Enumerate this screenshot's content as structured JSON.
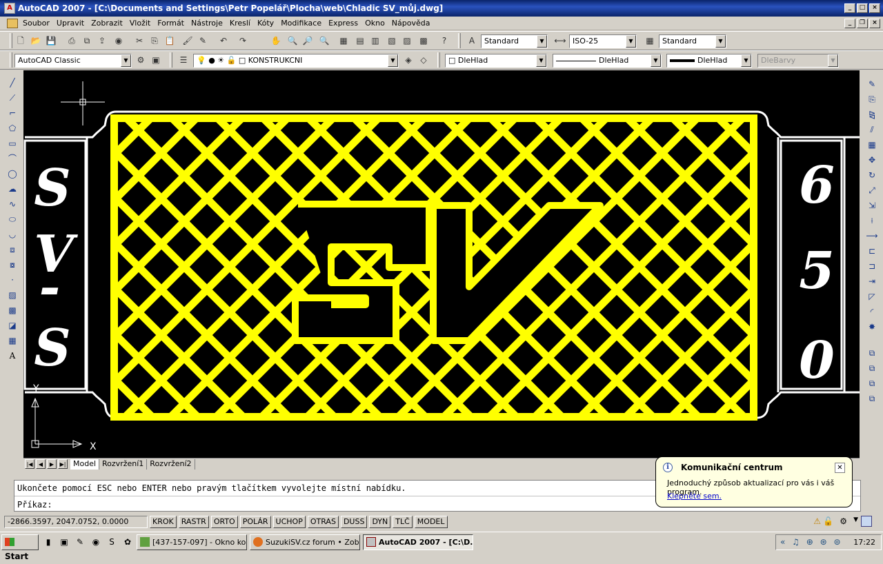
{
  "window": {
    "title": "AutoCAD 2007 - [C:\\Documents and Settings\\Petr Popelář\\Plocha\\web\\Chladic SV_můj.dwg]"
  },
  "menu": [
    "Soubor",
    "Upravit",
    "Zobrazit",
    "Vložit",
    "Formát",
    "Nástroje",
    "Kreslí",
    "Kóty",
    "Modifikace",
    "Express",
    "Okno",
    "Nápověda"
  ],
  "toolbar1": {
    "text_style": "Standard",
    "dim_style": "ISO-25",
    "table_style": "Standard"
  },
  "toolbar2": {
    "workspace": "AutoCAD Classic",
    "layer": "KONSTRUKCNI",
    "color": "DleHlad",
    "linetype": "DleHlad",
    "lineweight": "DleHlad",
    "plotstyle": "DleBarvy"
  },
  "drawing": {
    "left_letters": [
      "S",
      "V",
      "-",
      "S"
    ],
    "right_letters": [
      "6",
      "5",
      "0"
    ],
    "center_logo": "SV",
    "ucs_x": "X",
    "ucs_y": "Y",
    "colors": {
      "background": "#000000",
      "grille": "#ffff00",
      "outline": "#ffffff"
    }
  },
  "layout_tabs": [
    "Model",
    "Rozvržení1",
    "Rozvržení2"
  ],
  "command": {
    "history": "Ukončete pomocí ESC nebo ENTER nebo pravým tlačítkem vyvolejte místní nabídku.",
    "prompt": "Příkaz:"
  },
  "status": {
    "coordinates": "-2866.3597, 2047.0752, 0.0000",
    "toggles": [
      "KROK",
      "RASTR",
      "ORTO",
      "POLÁR",
      "UCHOP",
      "OTRAS",
      "DUSS",
      "DYN",
      "TLČ",
      "MODEL"
    ]
  },
  "balloon": {
    "title": "Komunikační centrum",
    "message": "Jednoduchý způsob aktualizací pro vás i váš program.",
    "link": "Klepněte sem."
  },
  "taskbar": {
    "start": "Start",
    "tasks": [
      "[437-157-097] - Okno ko...",
      "SuzukiSV.cz forum • Zobr...",
      "AutoCAD 2007 - [C:\\D..."
    ],
    "clock": "17:22"
  }
}
